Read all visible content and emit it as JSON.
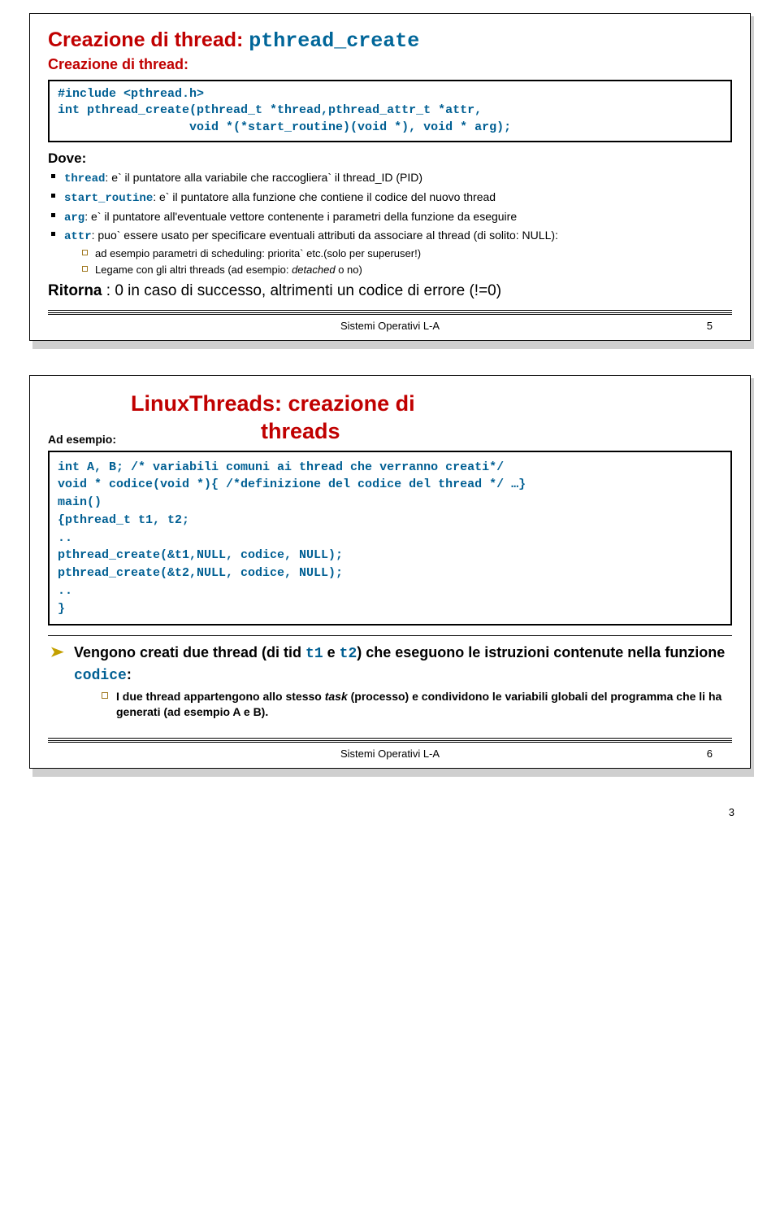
{
  "slide1": {
    "title_plain": "Creazione di thread: ",
    "title_mono": "pthread_create",
    "subtitle": "Creazione di thread:",
    "code_l1": "#include <pthread.h>",
    "code_l2": "int pthread_create(pthread_t *thread,pthread_attr_t *attr,",
    "code_l3": "                  void *(*start_routine)(void *), void * arg);",
    "dove": "Dove:",
    "b1_kw": "thread",
    "b1_txt": ": e` il puntatore alla variabile che raccogliera` il thread_ID (PID)",
    "b2_kw": "start_routine",
    "b2_txt": ": e` il puntatore alla funzione che contiene il codice del nuovo thread",
    "b3_kw": "arg",
    "b3_txt": ": e` il puntatore all'eventuale vettore contenente i parametri della funzione da eseguire",
    "b4_kw": "attr",
    "b4_txt": ": puo` essere usato per  specificare eventuali attributi da associare al thread (di solito: NULL):",
    "sub1": "ad esempio parametri di scheduling: priorita` etc.(solo per superuser!)",
    "sub2_pre": "Legame con gli altri threads (ad esempio: ",
    "sub2_it": "detached",
    "sub2_post": " o no)",
    "rit_b": "Ritorna",
    "rit_rest": " : 0 in caso di successo, altrimenti un codice di errore (!=0)",
    "footer_text": "Sistemi Operativi L-A",
    "footer_num": "5"
  },
  "slide2": {
    "ades": "Ad esempio:",
    "title_l1": "LinuxThreads: creazione di",
    "title_l2": "threads",
    "c_l1": "int A, B; /* variabili comuni ai thread che verranno creati*/",
    "c_l2": "void * codice(void *){ /*definizione del codice del thread */ …}",
    "c_l3": "main()",
    "c_l4": "{pthread_t t1, t2;",
    "c_l5": "..",
    "c_l6": "pthread_create(&t1,NULL, codice, NULL);",
    "c_l7": "pthread_create(&t2,NULL, codice, NULL);",
    "c_l8": "..",
    "c_l9": "}",
    "arrow_pre": "Vengono creati due thread (di tid ",
    "arrow_m1": "t1",
    "arrow_mid": " e ",
    "arrow_m2": "t2",
    "arrow_post1": ") che eseguono le istruzioni contenute nella funzione ",
    "arrow_m3": "codice",
    "arrow_post2": ":",
    "sub_pre": "I due thread appartengono allo stesso ",
    "sub_it": "task",
    "sub_post": " (processo) e  condividono le variabili globali del programma che li ha generati (ad esempio A e B).",
    "footer_text": "Sistemi Operativi L-A",
    "footer_num": "6"
  },
  "outer_page": "3"
}
